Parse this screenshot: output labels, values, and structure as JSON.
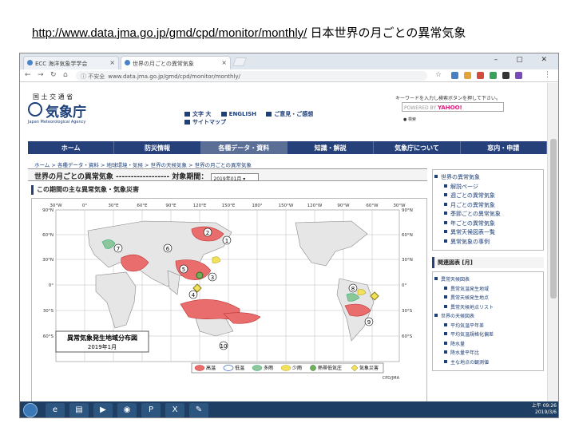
{
  "caption": {
    "url": "http://www.data.jma.go.jp/gmd/cpd/monitor/monthly/",
    "suffix": "日本世界の月ごとの異常気象"
  },
  "browser": {
    "tabs": [
      {
        "label": "ECC 海洋気象学学会"
      },
      {
        "label": "世界の月ごとの異常気象"
      }
    ],
    "address": {
      "warning": "ⓘ 不安全",
      "url": "www.data.jma.go.jp/gmd/cpd/monitor/monthly/"
    }
  },
  "site": {
    "ministry": "国 土 交 通 省",
    "logo_jp": "気象庁",
    "logo_en": "Japan Meteorological Agency",
    "top_links": [
      "文字 大",
      "ENGLISH",
      "ご意見・ご感想",
      "サイトマップ"
    ],
    "search": {
      "label": "キーワードを入力し検索ボタンを押して下さい。",
      "powered": "POWERED BY",
      "brand": "YAHOO!",
      "option": "● 検索"
    },
    "gnav": [
      "ホーム",
      "防災情報",
      "各種データ・資料",
      "知識・解説",
      "気象庁について",
      "窓内・申請"
    ],
    "breadcrumb": "ホーム > 各種データ・資料 > 地球環境・気候 > 世界の天候気象 > 世界の月ごとの異常気象",
    "page_title": "世界の月ごとの異常気象 ------------------ 対象期間：",
    "period": "2019年01月 ▾",
    "section": "この期間の主な異常気象・気象災害"
  },
  "sidebar": {
    "main": [
      "世界の異常気象",
      "解説ページ",
      "週ごとの異常気象",
      "月ごとの異常気象",
      "季節ごとの異常気象",
      "年ごとの異常気象",
      "異常天候図表一覧",
      "異常気象の事例"
    ],
    "related_header": "関連図表 [月]",
    "related": [
      {
        "label": "異常天候図表",
        "sub": false
      },
      {
        "label": "異常気温発生地域",
        "sub": true
      },
      {
        "label": "異常天候発生地点",
        "sub": true
      },
      {
        "label": "異常天候地点リスト",
        "sub": true
      },
      {
        "label": "世界の天候図表",
        "sub": false
      },
      {
        "label": "平均気温平年差",
        "sub": true
      },
      {
        "label": "平均気温規格化偏差",
        "sub": true
      },
      {
        "label": "降水量",
        "sub": true
      },
      {
        "label": "降水量平年比",
        "sub": true
      },
      {
        "label": "主な地点の観測値",
        "sub": true
      }
    ]
  },
  "map": {
    "lon_top": [
      "30°W",
      "0°",
      "30°E",
      "60°E",
      "90°E",
      "120°E",
      "150°E",
      "180°",
      "150°W",
      "120°W",
      "90°W",
      "60°W",
      "30°W"
    ],
    "lat_left": [
      "90°N",
      "60°N",
      "30°N",
      "0°",
      "30°S",
      "60°S"
    ],
    "lat_right": [
      "90°N",
      "60°N",
      "30°N",
      "0°",
      "30°S",
      "60°S"
    ],
    "markers": [
      "1",
      "2",
      "3",
      "4",
      "5",
      "6",
      "7",
      "8",
      "9",
      "10"
    ],
    "legend_title": "異常気象発生地域分布図",
    "legend_month": "2019年1月",
    "legend_items": [
      "高温",
      "低温",
      "多雨",
      "少雨",
      "熱帯低気圧",
      "気象災害"
    ],
    "credit": "CPD/JMA"
  },
  "taskbar": {
    "apps": [
      "e",
      "▤",
      "▶",
      "◉",
      "P",
      "X",
      "✎"
    ],
    "time": "上午 09:26",
    "date": "2019/3/6"
  }
}
